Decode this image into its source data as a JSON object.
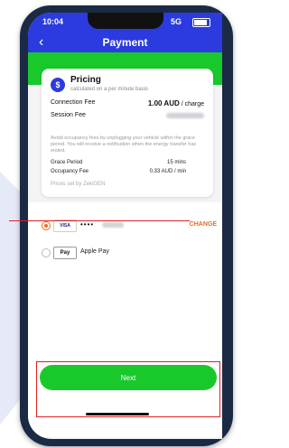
{
  "status": {
    "time": "10:04",
    "network": "5G"
  },
  "header": {
    "title": "Payment",
    "back_icon": "chevron-left-icon"
  },
  "colors": {
    "primary": "#2b3be0",
    "accent_green": "#19c92c",
    "change_orange": "#f06a1e",
    "highlight_red": "#e02020"
  },
  "pricing": {
    "title": "Pricing",
    "subtitle": "calculated on a per minute basis",
    "connection_fee_label": "Connection Fee",
    "connection_fee_value": "1.00 AUD",
    "connection_fee_unit": "/ charge",
    "session_fee_label": "Session Fee",
    "note": "Avoid occupancy fees by unplugging your vehicle within the grace period. You will receive a notification when the energy transfer has ended.",
    "grace_period_label": "Grace Period",
    "grace_period_value": "15 mins",
    "occupancy_fee_label": "Occupancy Fee",
    "occupancy_fee_value": "0.33 AUD / min",
    "set_by": "Prices set by ZekiGEN"
  },
  "payment": {
    "card_brand": "VISA",
    "card_mask": "••••",
    "change_label": "CHANGE",
    "apple_pay_badge": "Pay",
    "apple_pay_label": "Apple Pay"
  },
  "footer": {
    "next_label": "Next"
  }
}
